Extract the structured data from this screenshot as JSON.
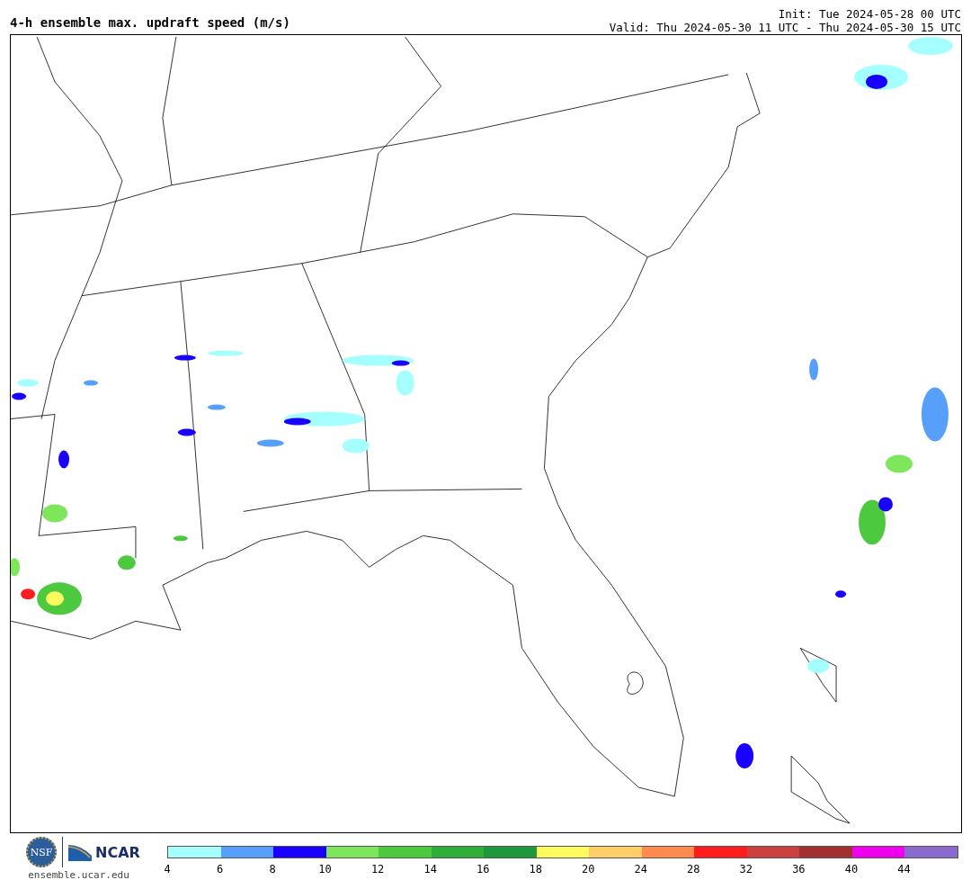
{
  "title": "4-h ensemble max. updraft speed (m/s)",
  "init": "Init: Tue 2024-05-28 00 UTC",
  "valid": "Valid: Thu 2024-05-30 11 UTC - Thu 2024-05-30 15 UTC",
  "logos": {
    "nsf": "NSF",
    "ncar": "NCAR",
    "site": "ensemble.ucar.edu"
  },
  "colorbar": [
    {
      "label": "4",
      "color": "#a6ffff"
    },
    {
      "label": "6",
      "color": "#569ffb"
    },
    {
      "label": "8",
      "color": "#1a00ff"
    },
    {
      "label": "10",
      "color": "#7de65a"
    },
    {
      "label": "12",
      "color": "#4dc940"
    },
    {
      "label": "14",
      "color": "#2fae39"
    },
    {
      "label": "16",
      "color": "#1f983c"
    },
    {
      "label": "18",
      "color": "#fefb5e"
    },
    {
      "label": "20",
      "color": "#fece69"
    },
    {
      "label": "24",
      "color": "#fe8a4e"
    },
    {
      "label": "28",
      "color": "#fe1c1c"
    },
    {
      "label": "32",
      "color": "#cc4040"
    },
    {
      "label": "36",
      "color": "#a33030"
    },
    {
      "label": "40",
      "color": "#ee00ee"
    },
    {
      "label": "44",
      "color": "#8b6acd"
    }
  ]
}
